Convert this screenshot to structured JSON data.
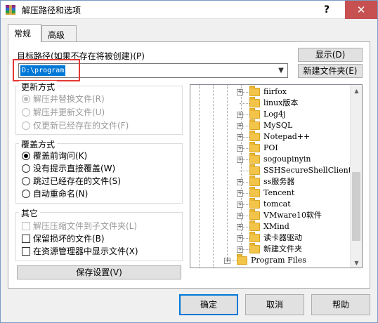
{
  "window": {
    "title": "解压路径和选项",
    "help_glyph": "?",
    "close_glyph": "✕"
  },
  "tabs": [
    {
      "label": "常规"
    },
    {
      "label": "高级"
    }
  ],
  "target": {
    "label": "目标路径(如果不存在将被创建)(P)",
    "value": "D:\\program",
    "show_button": "显示(D)",
    "new_folder_button": "新建文件夹(E)"
  },
  "update_mode": {
    "title": "更新方式",
    "options": [
      {
        "label": "解压并替换文件(R)",
        "checked": true
      },
      {
        "label": "解压并更新文件(U)",
        "checked": false
      },
      {
        "label": "仅更新已经存在的文件(F)",
        "checked": false
      }
    ]
  },
  "overwrite_mode": {
    "title": "覆盖方式",
    "options": [
      {
        "label": "覆盖前询问(K)",
        "checked": true
      },
      {
        "label": "没有提示直接覆盖(W)",
        "checked": false
      },
      {
        "label": "跳过已经存在的文件(S)",
        "checked": false
      },
      {
        "label": "自动重命名(N)",
        "checked": false
      }
    ]
  },
  "misc": {
    "title": "其它",
    "options": [
      {
        "label": "解压压缩文件到子文件夹(L)",
        "checked": false
      },
      {
        "label": "保留损坏的文件(B)",
        "checked": false
      },
      {
        "label": "在资源管理器中显示文件(X)",
        "checked": false
      }
    ]
  },
  "save_settings_button": "保存设置(V)",
  "folder_tree": [
    {
      "name": "fiirfox",
      "expandable": true
    },
    {
      "name": "linux版本",
      "expandable": false
    },
    {
      "name": "Log4j",
      "expandable": true
    },
    {
      "name": "MySQL",
      "expandable": true
    },
    {
      "name": "Notepad++",
      "expandable": true
    },
    {
      "name": "POI",
      "expandable": true
    },
    {
      "name": "sogoupinyin",
      "expandable": true
    },
    {
      "name": "SSHSecureShellClient-",
      "expandable": false
    },
    {
      "name": "ss服务器",
      "expandable": true
    },
    {
      "name": "Tencent",
      "expandable": true
    },
    {
      "name": "tomcat",
      "expandable": true
    },
    {
      "name": "VMware10软件",
      "expandable": true
    },
    {
      "name": "XMind",
      "expandable": true
    },
    {
      "name": "读卡器驱动",
      "expandable": true
    },
    {
      "name": "新建文件夹",
      "expandable": true
    }
  ],
  "tree_parent": {
    "name": "Program Files",
    "expandable": true
  },
  "scroll": {
    "up_glyph": "▲",
    "down_glyph": "▼"
  },
  "dialog_buttons": {
    "ok": "确定",
    "cancel": "取消",
    "help": "帮助"
  },
  "colors": {
    "selection": "#0078d7",
    "highlight_box": "#e53935",
    "close_button": "#c75050"
  }
}
